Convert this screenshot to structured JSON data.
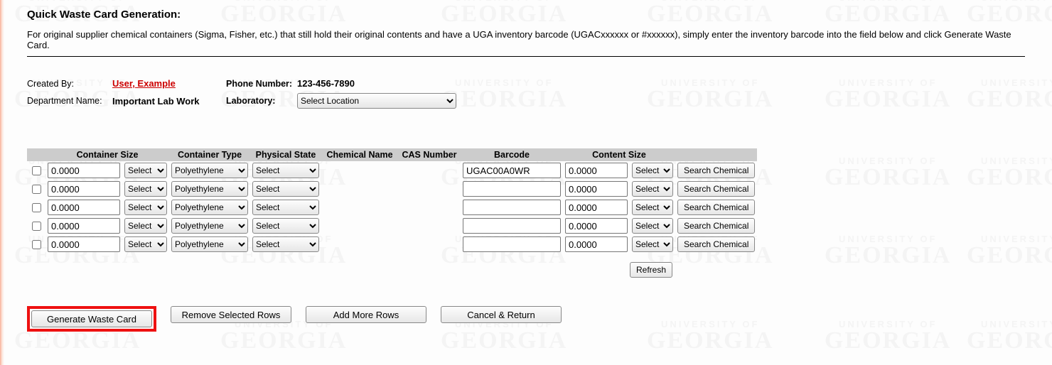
{
  "title": "Quick Waste Card Generation:",
  "instructions": "For original supplier chemical containers (Sigma, Fisher, etc.) that still hold their original contents and have a UGA inventory barcode (UGACxxxxxx or #xxxxxx), simply enter the inventory barcode into the field below and click Generate Waste Card.",
  "meta": {
    "created_by_label": "Created By:",
    "created_by_value": "User, Example",
    "phone_label": "Phone Number:",
    "phone_value": "123-456-7890",
    "dept_label": "Department Name:",
    "dept_value": "Important Lab Work",
    "lab_label": "Laboratory:",
    "lab_select": "Select Location"
  },
  "headers": {
    "container_size": "Container Size",
    "container_type": "Container Type",
    "physical_state": "Physical State",
    "chemical_name": "Chemical Name",
    "cas_number": "CAS Number",
    "barcode": "Barcode",
    "content_size": "Content Size"
  },
  "defaults": {
    "unit_select": "Select",
    "ctype_select": "Polyethylene",
    "pstate_select": "Select",
    "search_button": "Search Chemical"
  },
  "rows": [
    {
      "csize": "0.0000",
      "barcode": "UGAC00A0WR",
      "consize": "0.0000"
    },
    {
      "csize": "0.0000",
      "barcode": "",
      "consize": "0.0000"
    },
    {
      "csize": "0.0000",
      "barcode": "",
      "consize": "0.0000"
    },
    {
      "csize": "0.0000",
      "barcode": "",
      "consize": "0.0000"
    },
    {
      "csize": "0.0000",
      "barcode": "",
      "consize": "0.0000"
    }
  ],
  "refresh_button": "Refresh",
  "actions": {
    "generate": "Generate Waste Card",
    "remove": "Remove Selected Rows",
    "add": "Add More Rows",
    "cancel": "Cancel & Return"
  },
  "watermark": {
    "line1": "UNIVERSITY OF",
    "line2": "GEORGIA"
  }
}
